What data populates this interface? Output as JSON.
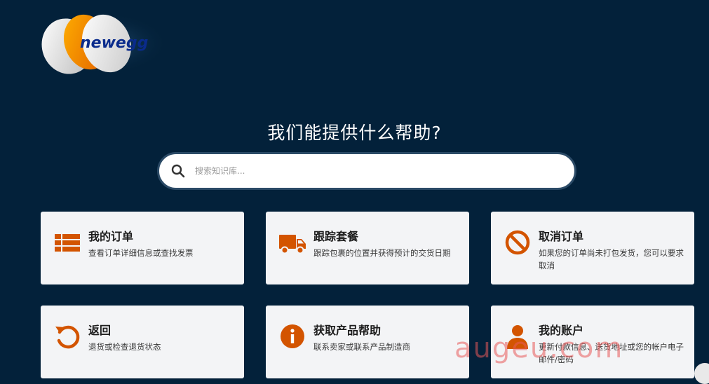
{
  "logo": {
    "text": "newegg"
  },
  "heading": "我们能提供什么帮助?",
  "search": {
    "placeholder": "搜索知识库..."
  },
  "cards": [
    {
      "title": "我的订单",
      "desc": "查看订单详细信息或查找发票",
      "icon": "list-icon"
    },
    {
      "title": "跟踪套餐",
      "desc": "跟踪包裹的位置并获得预计的交货日期",
      "icon": "truck-icon"
    },
    {
      "title": "取消订单",
      "desc": "如果您的订单尚未打包发货，您可以要求取消",
      "icon": "ban-icon"
    },
    {
      "title": "返回",
      "desc": "退货或检查退货状态",
      "icon": "undo-icon"
    },
    {
      "title": "获取产品帮助",
      "desc": "联系卖家或联系产品制造商",
      "icon": "info-icon"
    },
    {
      "title": "我的账户",
      "desc": "更新付款信息、送货地址或您的帐户电子邮件/密码",
      "icon": "user-icon"
    }
  ],
  "watermark": "augeu.com",
  "colors": {
    "background": "#03213a",
    "accent": "#d35400",
    "card": "#f3f4f6"
  }
}
